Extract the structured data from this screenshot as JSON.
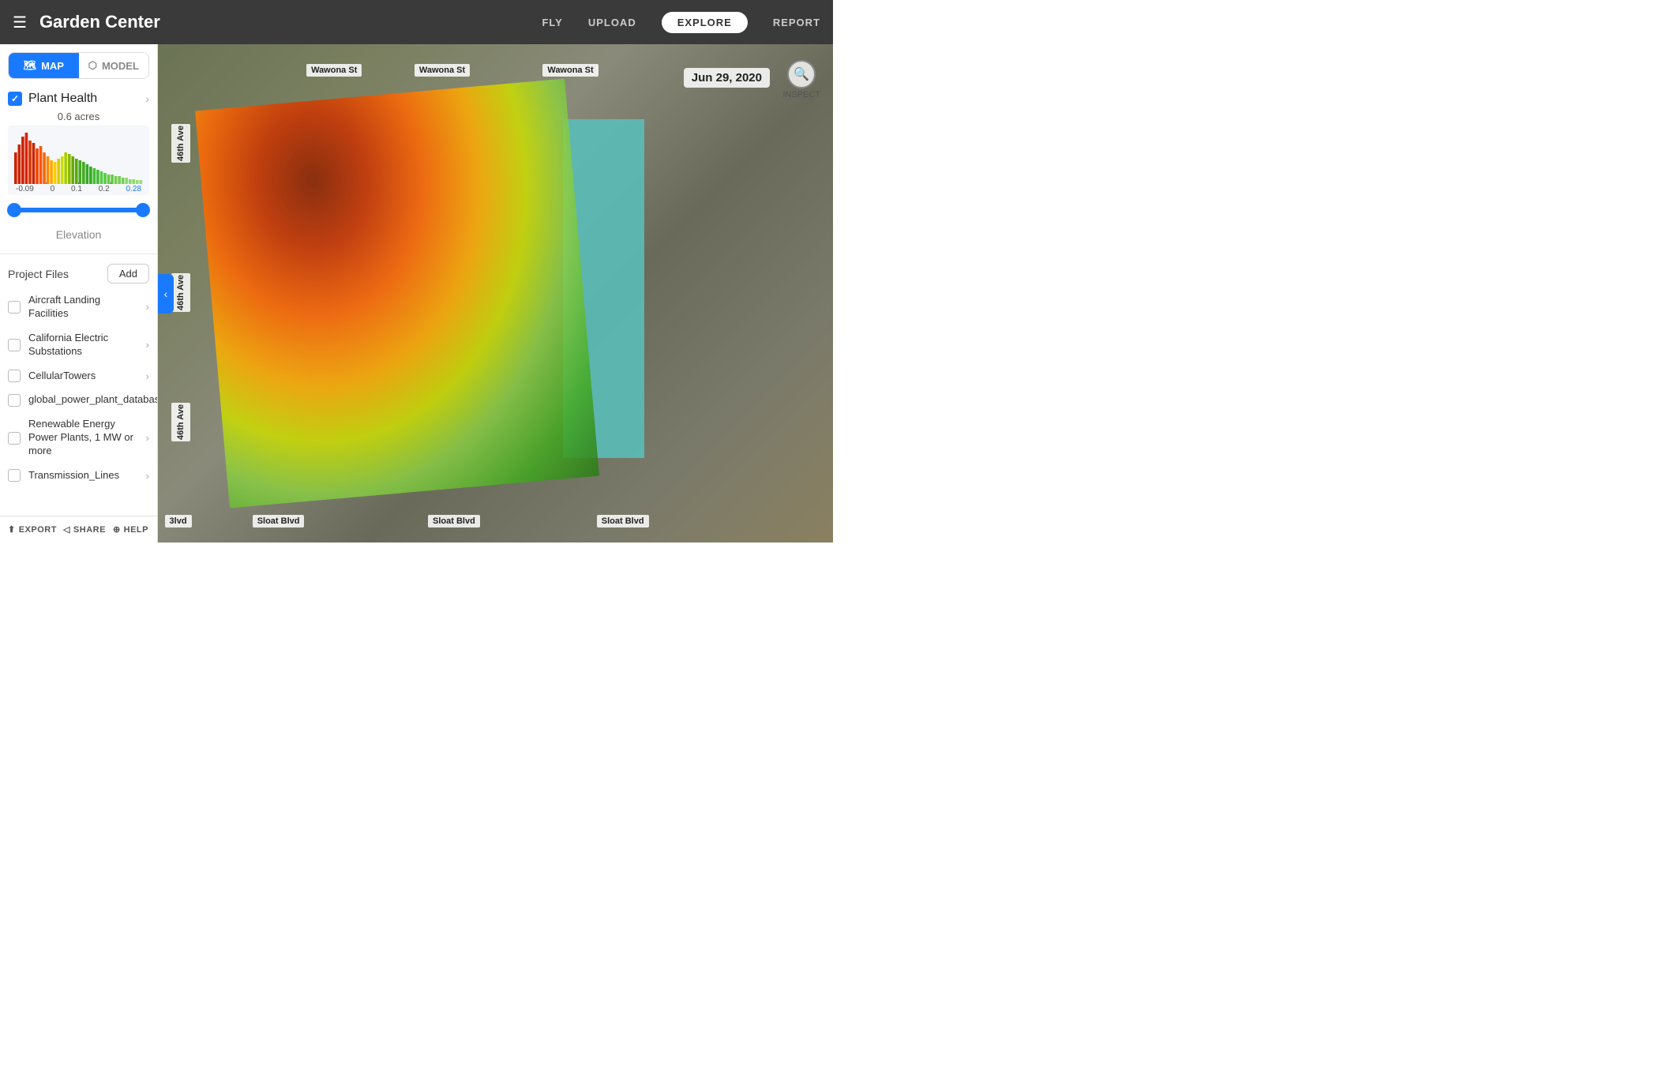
{
  "header": {
    "menu_icon": "☰",
    "title": "Garden Center",
    "nav": [
      {
        "label": "FLY",
        "active": false
      },
      {
        "label": "UPLOAD",
        "active": false
      },
      {
        "label": "EXPLORE",
        "active": true
      },
      {
        "label": "REPORT",
        "active": false
      }
    ]
  },
  "sidebar": {
    "view_toggle": {
      "map_label": "MAP",
      "model_label": "MODEL",
      "active": "map"
    },
    "plant_health": {
      "label": "Plant Health",
      "checked": true,
      "acres": "0.6 acres"
    },
    "histogram": {
      "labels": [
        "-0.09",
        "0",
        "0.1",
        "0.2",
        "0.28"
      ]
    },
    "elevation_label": "Elevation",
    "project_files": {
      "title": "Project Files",
      "add_label": "Add",
      "items": [
        {
          "label": "Aircraft Landing Facilities",
          "checked": false
        },
        {
          "label": "California Electric Substations",
          "checked": false
        },
        {
          "label": "CellularTowers",
          "checked": false
        },
        {
          "label": "global_power_plant_database",
          "checked": false
        },
        {
          "label": "Renewable Energy Power Plants, 1 MW or more",
          "checked": false
        },
        {
          "label": "Transmission_Lines",
          "checked": false
        }
      ]
    },
    "footer": {
      "export_label": "EXPORT",
      "share_label": "SHARE",
      "help_label": "HELP"
    }
  },
  "map": {
    "date_label": "Jun 29, 2020",
    "inspect_label": "INSPECT",
    "streets": [
      {
        "label": "Wawona St",
        "top": "4%",
        "left": "22%"
      },
      {
        "label": "Wawona St",
        "top": "4%",
        "left": "38%"
      },
      {
        "label": "Wawona St",
        "top": "4%",
        "left": "57%"
      },
      {
        "label": "46th Ave",
        "top": "16%",
        "left": "5.5%",
        "rotate": true
      },
      {
        "label": "46th Ave",
        "top": "46%",
        "left": "5.5%",
        "rotate": true
      },
      {
        "label": "46th Ave",
        "top": "74%",
        "left": "5.5%",
        "rotate": true
      },
      {
        "label": "Sloat Blvd",
        "bottom": "2%",
        "left": "14%"
      },
      {
        "label": "Sloat Blvd",
        "bottom": "2%",
        "left": "42%"
      },
      {
        "label": "Sloat Blvd",
        "bottom": "2%",
        "left": "66%"
      },
      {
        "label": "3lvd",
        "bottom": "2%",
        "left": "3%"
      }
    ]
  },
  "icons": {
    "map_icon": "🗺",
    "model_icon": "⬡",
    "export_icon": "⬆",
    "share_icon": "◁",
    "help_icon": "⊕",
    "inspect_icon": "🔍"
  }
}
